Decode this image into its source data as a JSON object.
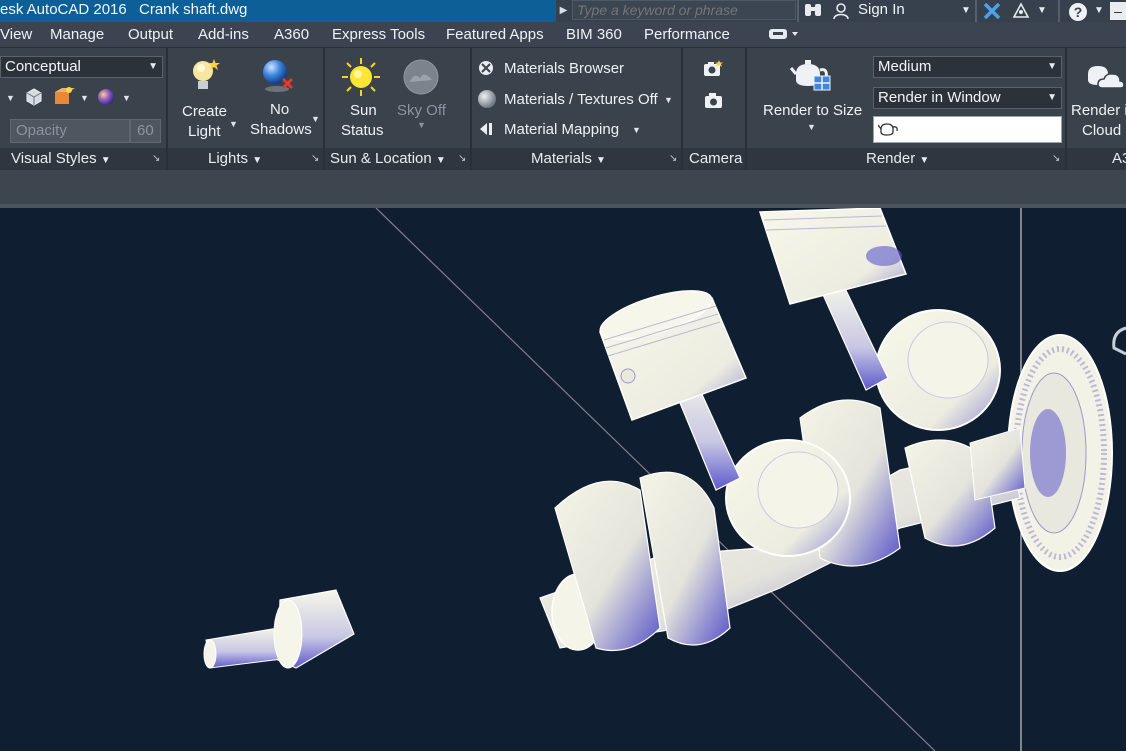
{
  "titlebar": {
    "app_title": "esk AutoCAD 2016",
    "doc_title": "Crank shaft.dwg",
    "search_placeholder": "Type a keyword or phrase",
    "sign_in": "Sign In"
  },
  "tabs": [
    "View",
    "Manage",
    "Output",
    "Add-ins",
    "A360",
    "Express Tools",
    "Featured Apps",
    "BIM 360",
    "Performance"
  ],
  "visual_styles": {
    "style_value": "Conceptual",
    "opacity_label": "Opacity",
    "opacity_value": "60",
    "panel_label": "Visual Styles"
  },
  "lights": {
    "create_light_line1": "Create",
    "create_light_line2": "Light",
    "no_shadows_line1": "No",
    "no_shadows_line2": "Shadows",
    "panel_label": "Lights"
  },
  "sun_location": {
    "sun_status_line1": "Sun",
    "sun_status_line2": "Status",
    "sky_off_label": "Sky Off",
    "panel_label": "Sun & Location"
  },
  "materials": {
    "browser": "Materials Browser",
    "textures": "Materials / Textures Off",
    "mapping": "Material Mapping",
    "panel_label": "Materials"
  },
  "camera": {
    "panel_label": "Camera"
  },
  "render": {
    "render_to_size": "Render to Size",
    "quality": "Medium",
    "target": "Render in Window",
    "panel_label": "Render"
  },
  "a360": {
    "render_cloud_line1": "Render i",
    "render_cloud_line2": "Cloud",
    "panel_label": "A3"
  },
  "colors": {
    "titlebar": "#0d5f97",
    "ribbon": "#3a424c",
    "viewport": "#0f1f31",
    "model_light": "#f2f2e4",
    "model_shade": "#4a47c8"
  }
}
